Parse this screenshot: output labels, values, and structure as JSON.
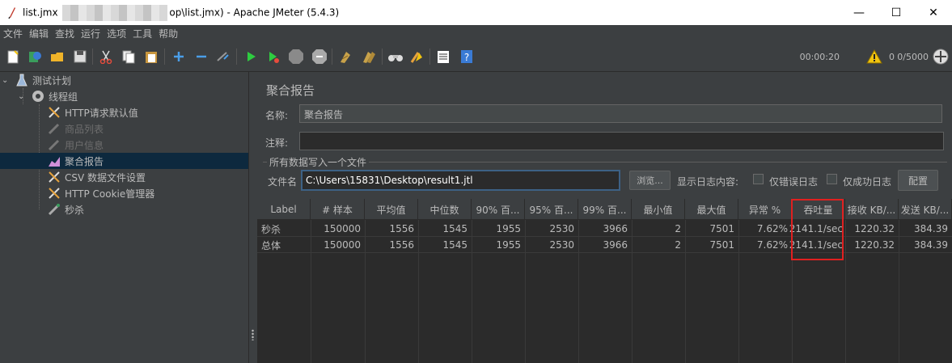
{
  "window": {
    "title_prefix": "list.jmx",
    "title_suffix": "op\\list.jmx) - Apache JMeter (5.4.3)",
    "minimize": "—",
    "maximize": "☐",
    "close": "✕"
  },
  "menu": [
    "文件",
    "编辑",
    "查找",
    "运行",
    "选项",
    "工具",
    "帮助"
  ],
  "toolbar": {
    "timer": "00:00:20",
    "warnings": "0",
    "threads": "0/5000"
  },
  "tree": [
    {
      "label": "测试计划",
      "icon": "flask-icon"
    },
    {
      "label": "线程组",
      "icon": "gear-icon"
    },
    {
      "label": "HTTP请求默认值",
      "icon": "wrench-icon"
    },
    {
      "label": "商品列表",
      "icon": "pipette-icon"
    },
    {
      "label": "用户信息",
      "icon": "pipette-icon"
    },
    {
      "label": "聚合报告",
      "icon": "chart-icon"
    },
    {
      "label": "CSV 数据文件设置",
      "icon": "wrench-icon"
    },
    {
      "label": "HTTP Cookie管理器",
      "icon": "wrench-icon"
    },
    {
      "label": "秒杀",
      "icon": "pipette-icon"
    }
  ],
  "panel": {
    "title": "聚合报告",
    "name_label": "名称:",
    "name_value": "聚合报告",
    "comment_label": "注释:",
    "comment_value": "",
    "group_title": "所有数据写入一个文件",
    "file_label": "文件名",
    "file_value": "C:\\Users\\15831\\Desktop\\result1.jtl",
    "browse_button": "浏览...",
    "log_label": "显示日志内容:",
    "errors_only": "仅错误日志",
    "success_only": "仅成功日志",
    "configure_button": "配置"
  },
  "table": {
    "headers": [
      "Label",
      "# 样本",
      "平均值",
      "中位数",
      "90% 百...",
      "95% 百...",
      "99% 百...",
      "最小值",
      "最大值",
      "异常 %",
      "吞吐量",
      "接收 KB/...",
      "发送 KB/..."
    ],
    "rows": [
      [
        "秒杀",
        "150000",
        "1556",
        "1545",
        "1955",
        "2530",
        "3966",
        "2",
        "7501",
        "7.62%",
        "2141.1/sec",
        "1220.32",
        "384.39"
      ],
      [
        "总体",
        "150000",
        "1556",
        "1545",
        "1955",
        "2530",
        "3966",
        "2",
        "7501",
        "7.62%",
        "2141.1/sec",
        "1220.32",
        "384.39"
      ]
    ]
  },
  "colors": {
    "background": "#3c3f41",
    "table_background": "#2b2b2b",
    "selection": "#0d293e",
    "highlight_border": "#e02020"
  }
}
